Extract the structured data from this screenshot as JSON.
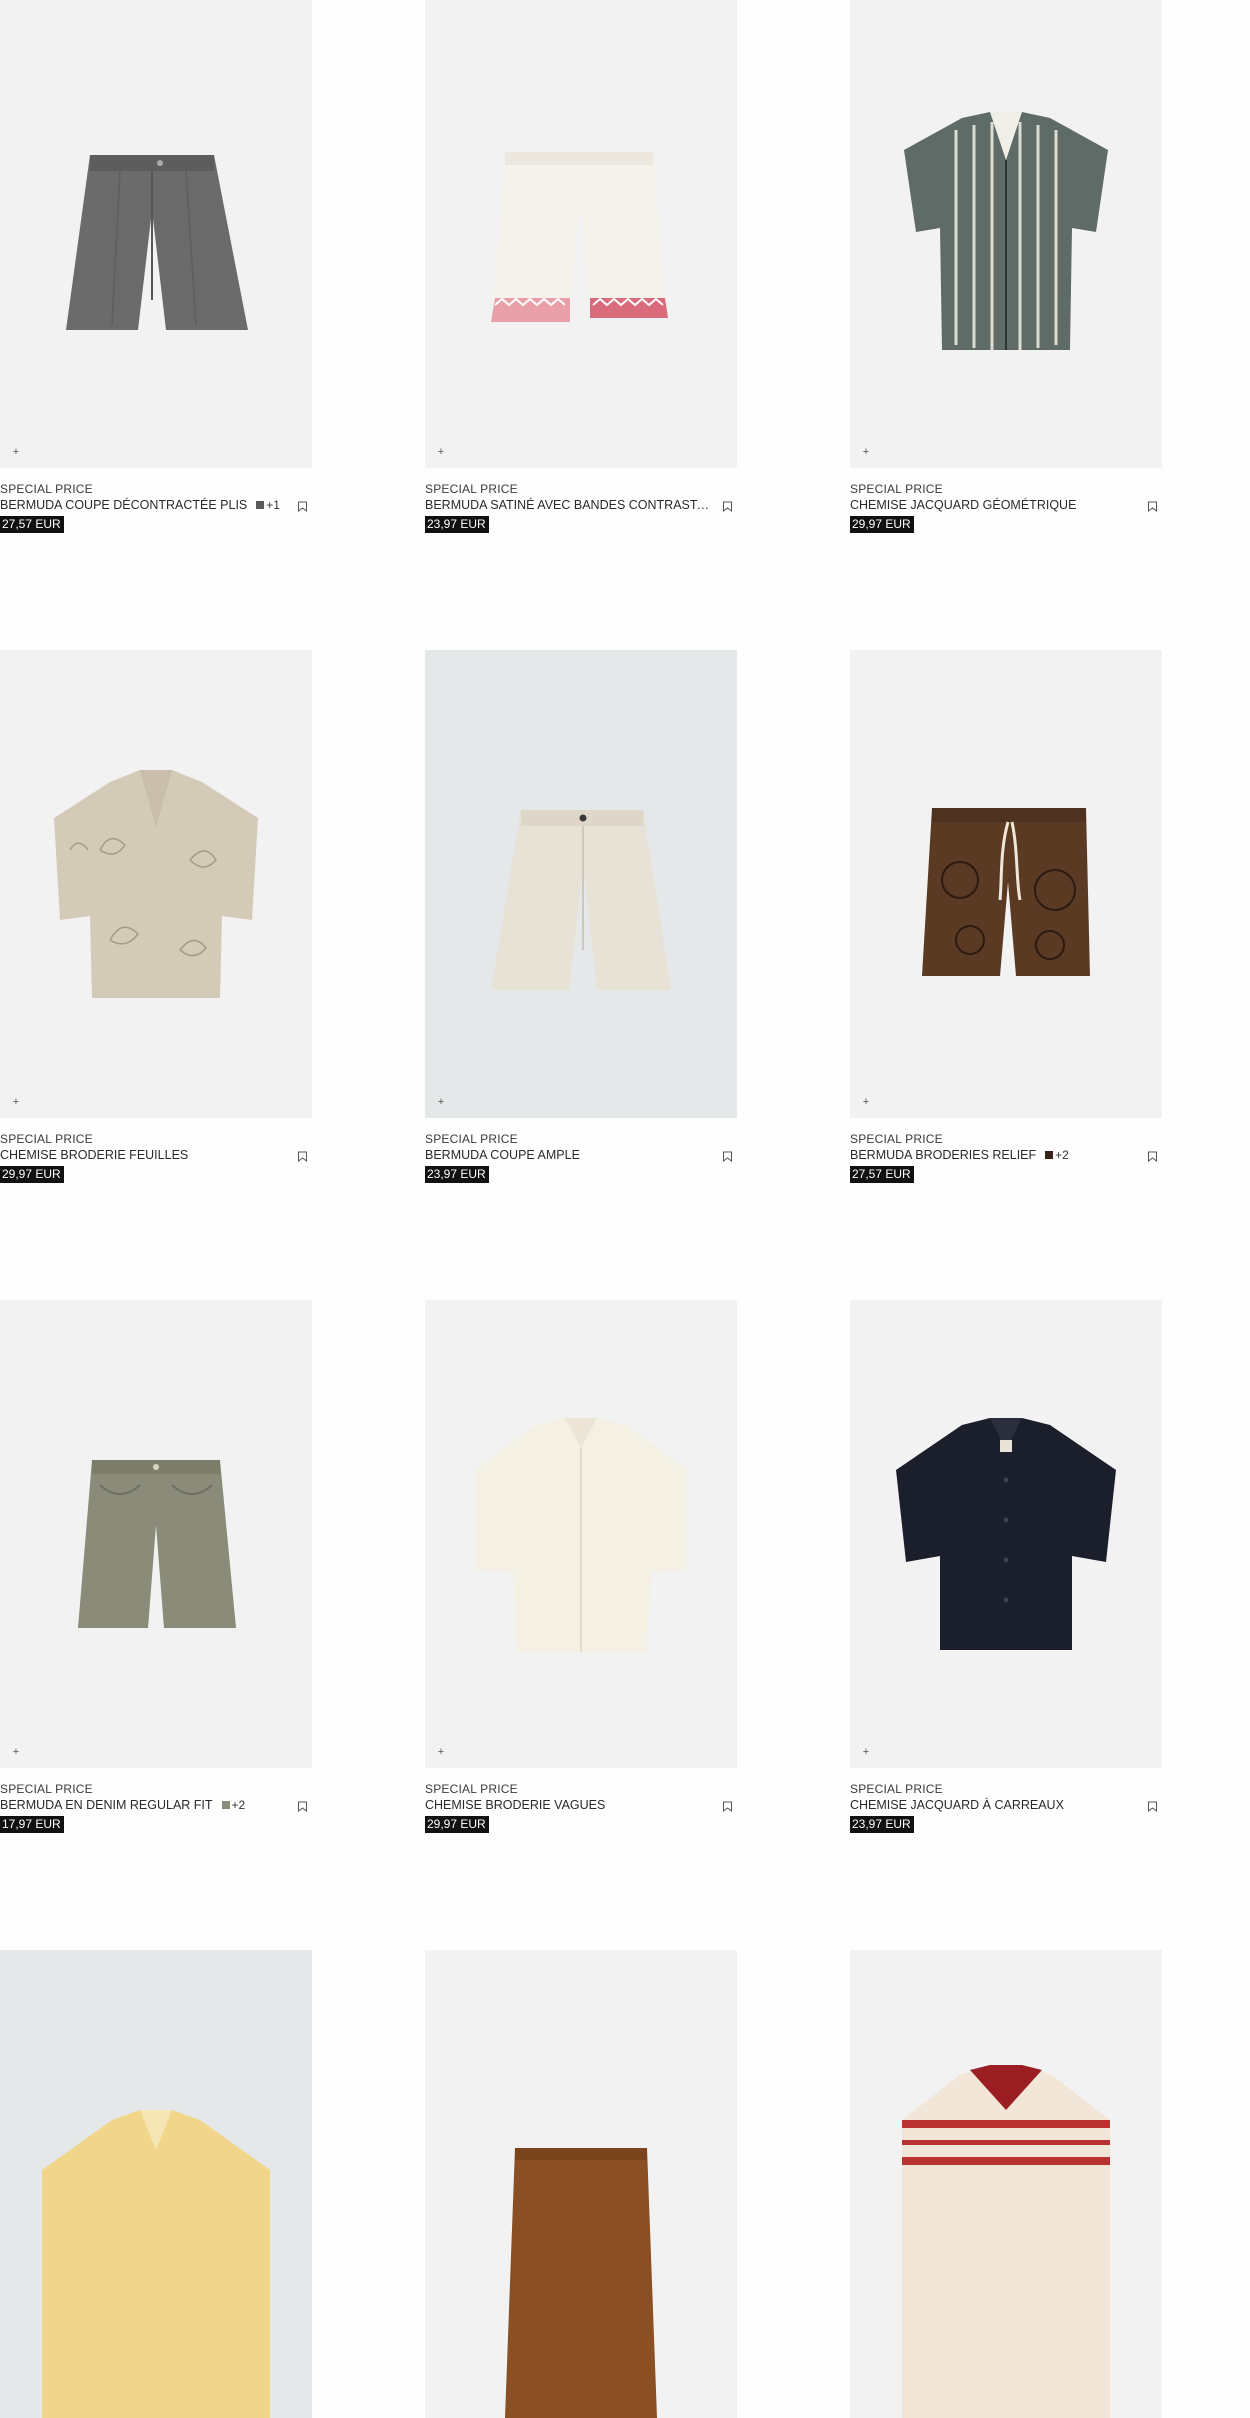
{
  "colors": {
    "tile_grey": "#f2f2f2",
    "tile_blue_grey": "#e4e8e9",
    "price_bg": "#111111"
  },
  "products": [
    {
      "label": "SPECIAL PRICE",
      "name": "BERMUDA COUPE DÉCONTRACTÉE PLIS",
      "price": "27,57 EUR",
      "extra_colors": "+1",
      "swatch": "#5a5a5a",
      "icon": "grey-pleated-shorts"
    },
    {
      "label": "SPECIAL PRICE",
      "name": "BERMUDA SATINÉ AVEC BANDES CONTRASTANTES",
      "price": "23,97 EUR",
      "icon": "cream-satin-shorts"
    },
    {
      "label": "SPECIAL PRICE",
      "name": "CHEMISE JACQUARD GÉOMÉTRIQUE",
      "price": "29,97 EUR",
      "icon": "geometric-jacquard-shirt"
    },
    {
      "label": "SPECIAL PRICE",
      "name": "CHEMISE BRODERIE FEUILLES",
      "price": "29,97 EUR",
      "icon": "leaf-embroidery-shirt"
    },
    {
      "label": "SPECIAL PRICE",
      "name": "BERMUDA COUPE AMPLE",
      "price": "23,97 EUR",
      "icon": "ecru-wide-shorts"
    },
    {
      "label": "SPECIAL PRICE",
      "name": "BERMUDA BRODERIES RELIEF",
      "price": "27,57 EUR",
      "extra_colors": "+2",
      "swatch": "#4a2a1c",
      "icon": "brown-embroidered-shorts"
    },
    {
      "label": "SPECIAL PRICE",
      "name": "BERMUDA EN DENIM REGULAR FIT",
      "price": "17,97 EUR",
      "extra_colors": "+2",
      "swatch": "#8c8c7a",
      "icon": "khaki-denim-shorts"
    },
    {
      "label": "SPECIAL PRICE",
      "name": "CHEMISE BRODERIE VAGUES",
      "price": "29,97 EUR",
      "icon": "wave-embroidery-shirt"
    },
    {
      "label": "SPECIAL PRICE",
      "name": "CHEMISE JACQUARD À CARREAUX",
      "price": "23,97 EUR",
      "icon": "navy-check-shirt"
    },
    {
      "icon": "yellow-knit-shirt"
    },
    {
      "icon": "brown-shorts"
    },
    {
      "icon": "striped-polo"
    }
  ]
}
